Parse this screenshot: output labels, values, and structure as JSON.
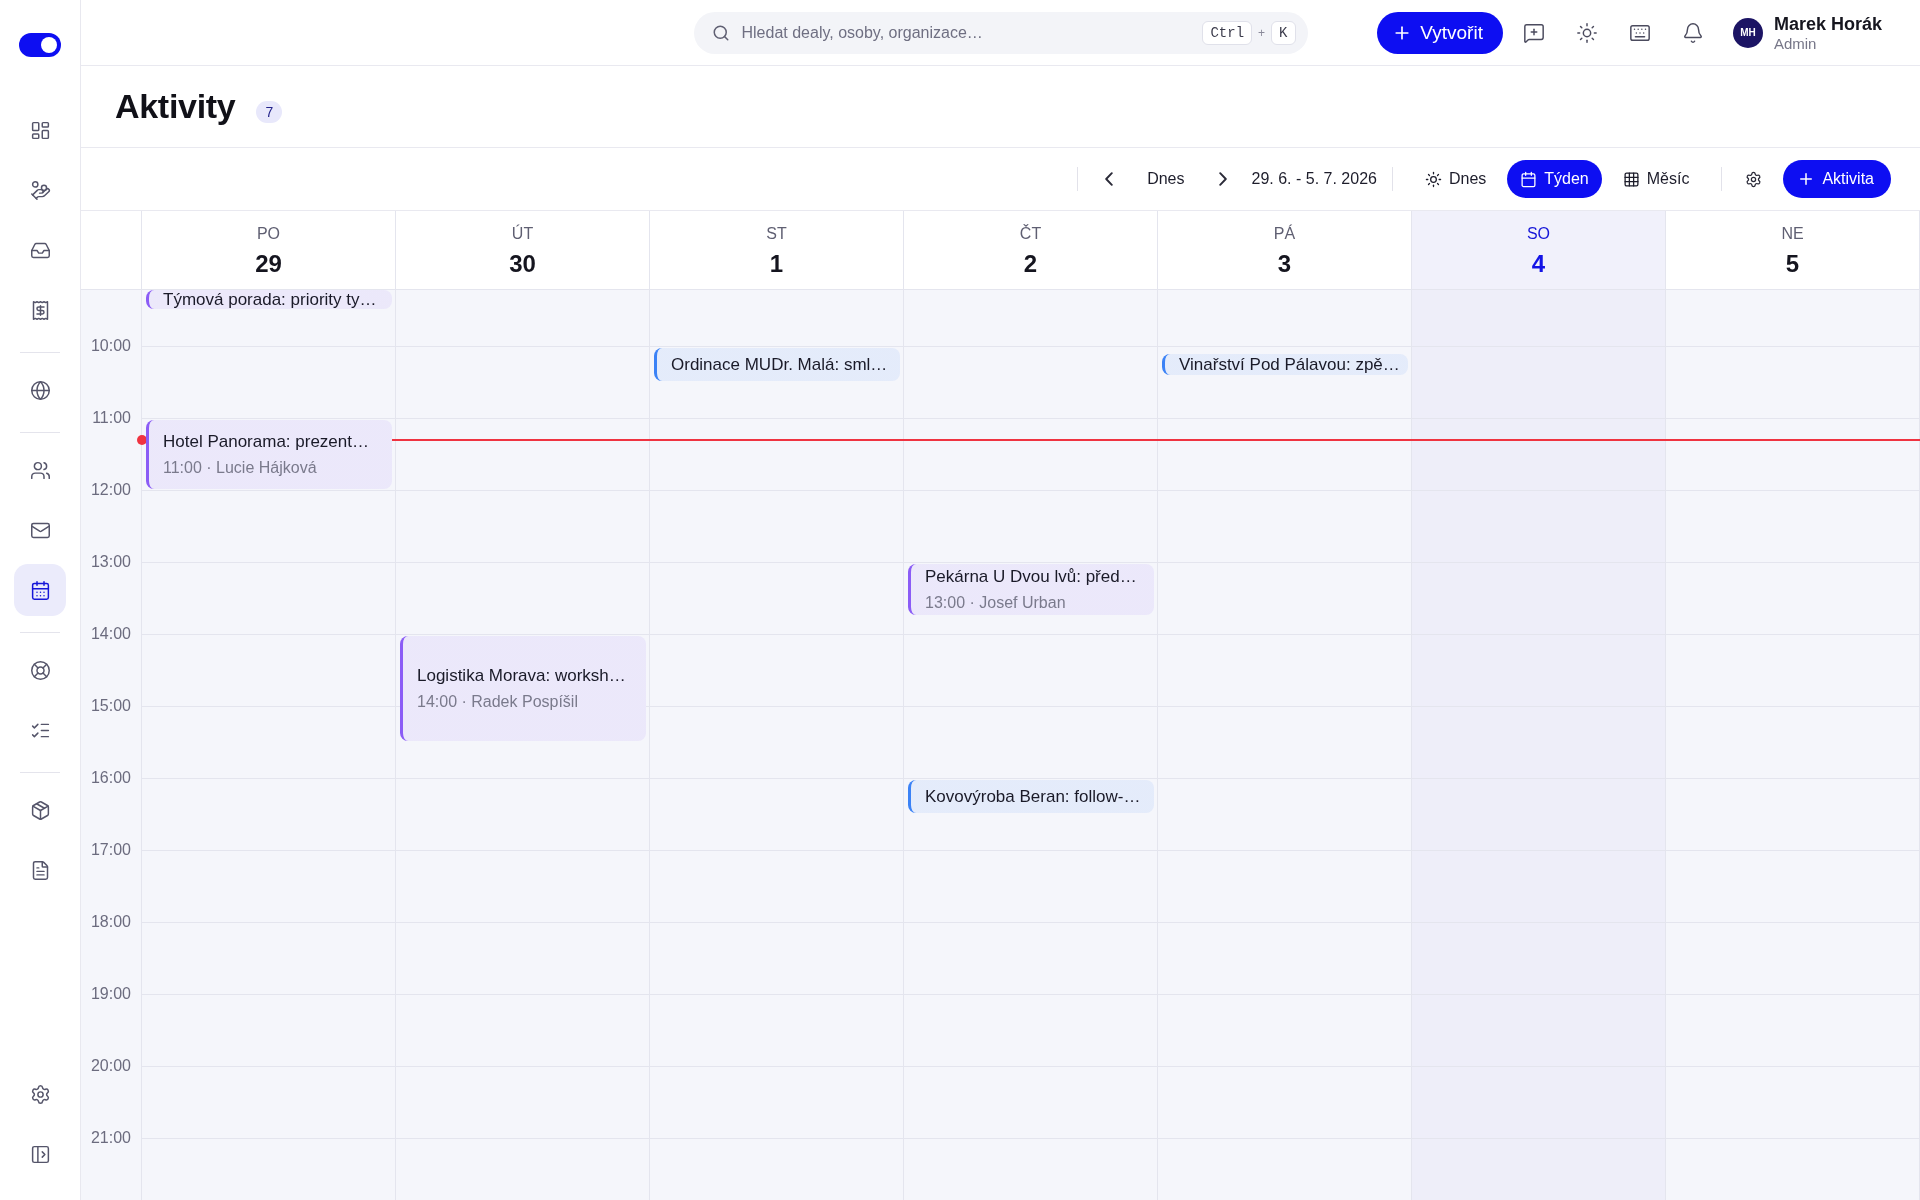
{
  "sidebar": {
    "toggle": {
      "on": true
    },
    "groups": [
      [
        {
          "selected": false
        },
        {
          "selected": false
        },
        {
          "selected": false
        },
        {
          "selected": false
        }
      ],
      [
        {
          "selected": false
        }
      ],
      [
        {
          "selected": false
        },
        {
          "selected": false
        },
        {
          "selected": true
        }
      ],
      [
        {
          "selected": false
        },
        {
          "selected": false
        }
      ],
      [
        {
          "selected": false
        },
        {
          "selected": false
        }
      ]
    ]
  },
  "top_bar": {
    "search": {
      "placeholder": "Hledat dealy, osoby, organizace…",
      "shortcut": [
        {
          "kind": "key",
          "text": "Ctrl"
        },
        {
          "kind": "separator",
          "text": "+"
        },
        {
          "kind": "key",
          "text": "K"
        }
      ]
    },
    "create_button": "Vytvořit",
    "user": {
      "initials": "MH",
      "name": "Marek Horák",
      "role": "Admin"
    }
  },
  "page": {
    "title": "Aktivity",
    "count": "7"
  },
  "toolbar": {
    "today_button": "Dnes",
    "date_range": "29. 6. - 5. 7. 2026",
    "views": [
      {
        "label": "Dnes",
        "selected": false
      },
      {
        "label": "Týden",
        "selected": true
      },
      {
        "label": "Měsíc",
        "selected": false
      }
    ],
    "add_button": "Aktivita"
  },
  "calendar": {
    "hours": [
      "10:00",
      "11:00",
      "12:00",
      "13:00",
      "14:00",
      "15:00",
      "16:00",
      "17:00",
      "18:00",
      "19:00",
      "20:00",
      "21:00"
    ],
    "days": [
      {
        "weekday": "PO",
        "date": "29",
        "today": false,
        "events": [
          {
            "title": "Týmová porada: priority ty…",
            "color": "#8b5cf6"
          },
          {
            "title": "Hotel Panorama: prezent…",
            "subtitle": "11:00 · Lucie Hájková",
            "color": "#8b5cf6"
          }
        ]
      },
      {
        "weekday": "ÚT",
        "date": "30",
        "today": false,
        "events": [
          {
            "title": "Logistika Morava: worksh…",
            "subtitle": "14:00 · Radek Pospíšil",
            "color": "#8b5cf6"
          }
        ]
      },
      {
        "weekday": "ST",
        "date": "1",
        "today": false,
        "events": [
          {
            "title": "Ordinace MUDr. Malá: sml…",
            "color": "#3b82f6"
          }
        ]
      },
      {
        "weekday": "ČT",
        "date": "2",
        "today": false,
        "events": [
          {
            "title": "Pekárna U Dvou lvů: před…",
            "subtitle": "13:00 · Josef Urban",
            "color": "#8b5cf6"
          },
          {
            "title": "Kovovýroba Beran: follow-…",
            "color": "#3b82f6"
          }
        ]
      },
      {
        "weekday": "PÁ",
        "date": "3",
        "today": false,
        "events": [
          {
            "title": "Vinařství Pod Pálavou: zpě…",
            "color": "#3b82f6"
          }
        ]
      },
      {
        "weekday": "SO",
        "date": "4",
        "today": true
      },
      {
        "weekday": "NE",
        "date": "5",
        "today": false
      }
    ]
  }
}
